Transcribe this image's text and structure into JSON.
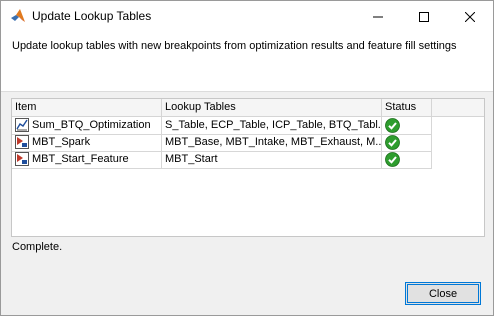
{
  "window": {
    "title": "Update Lookup Tables"
  },
  "banner": {
    "text": "Update lookup tables with new breakpoints from optimization results and feature fill settings"
  },
  "table": {
    "headers": {
      "item": "Item",
      "tables": "Lookup Tables",
      "status": "Status"
    },
    "rows": [
      {
        "item": "Sum_BTQ_Optimization",
        "tables": "S_Table, ECP_Table, ICP_Table, BTQ_Tabl...",
        "status": "complete",
        "icon": "optimization-icon"
      },
      {
        "item": "MBT_Spark",
        "tables": "MBT_Base, MBT_Intake, MBT_Exhaust, M...",
        "status": "complete",
        "icon": "feature-icon"
      },
      {
        "item": "MBT_Start_Feature",
        "tables": "MBT_Start",
        "status": "complete",
        "icon": "feature-icon"
      }
    ]
  },
  "status_text": "Complete.",
  "buttons": {
    "close": "Close"
  },
  "colors": {
    "accent": "#0078d7",
    "check_green": "#2e9d2e"
  }
}
